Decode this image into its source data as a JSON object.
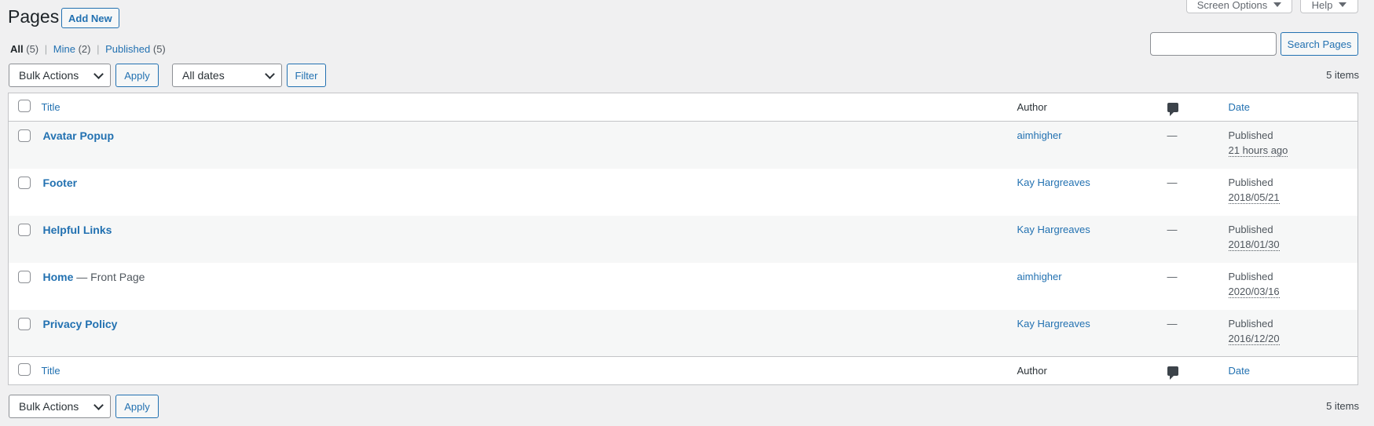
{
  "screen_meta": {
    "screen_options_label": "Screen Options",
    "help_label": "Help"
  },
  "header": {
    "title": "Pages",
    "add_new_label": "Add New"
  },
  "views": {
    "all_label": "All",
    "all_count": "(5)",
    "mine_label": "Mine",
    "mine_count": "(2)",
    "published_label": "Published",
    "published_count": "(5)",
    "separator": "|"
  },
  "search": {
    "value": "",
    "button_label": "Search Pages"
  },
  "tablenav_top": {
    "bulk_actions": "Bulk Actions",
    "apply_label": "Apply",
    "date_filter": "All dates",
    "filter_label": "Filter",
    "items_count": "5 items"
  },
  "table": {
    "columns": {
      "title": "Title",
      "author": "Author",
      "date": "Date"
    },
    "rows": [
      {
        "title": "Avatar Popup",
        "state": "",
        "author": "aimhigher",
        "comments": "—",
        "status": "Published",
        "date": "21 hours ago"
      },
      {
        "title": "Footer",
        "state": "",
        "author": "Kay Hargreaves",
        "comments": "—",
        "status": "Published",
        "date": "2018/05/21"
      },
      {
        "title": "Helpful Links",
        "state": "",
        "author": "Kay Hargreaves",
        "comments": "—",
        "status": "Published",
        "date": "2018/01/30"
      },
      {
        "title": "Home",
        "state": " — Front Page",
        "author": "aimhigher",
        "comments": "—",
        "status": "Published",
        "date": "2020/03/16"
      },
      {
        "title": "Privacy Policy",
        "state": "",
        "author": "Kay Hargreaves",
        "comments": "—",
        "status": "Published",
        "date": "2016/12/20"
      }
    ]
  },
  "tablenav_bottom": {
    "bulk_actions": "Bulk Actions",
    "apply_label": "Apply",
    "items_count": "5 items"
  },
  "colors": {
    "link": "#2271b1",
    "background": "#f0f0f1",
    "border": "#c3c4c7"
  }
}
